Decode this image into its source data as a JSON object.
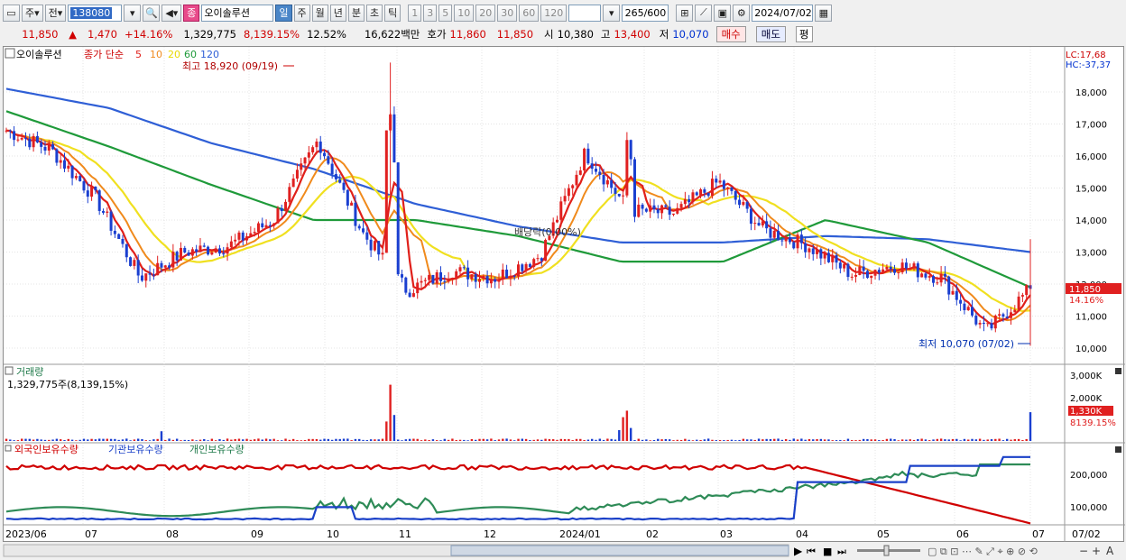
{
  "toolbar": {
    "mode_day": "주",
    "mode_prev": "전",
    "stock_code": "138080",
    "stock_name": "오이솔루션",
    "periods": [
      "일",
      "주",
      "월",
      "년",
      "분",
      "초",
      "틱"
    ],
    "intervals": [
      "1",
      "3",
      "5",
      "10",
      "20",
      "30",
      "60",
      "120"
    ],
    "count": "265",
    "count_max": "/600",
    "date": "2024/07/02",
    "name_badge": "종"
  },
  "quote": {
    "price": "11,850",
    "arrow": "▲",
    "change": "1,470",
    "change_pct": "+14.16%",
    "volume": "1,329,775",
    "vol_ratio": "8,139.15%",
    "turnover": "12.52%",
    "amount": "16,622백만",
    "bid_label": "호가",
    "ask": "11,860",
    "bid": "11,850",
    "open_label": "시",
    "open": "10,380",
    "high_label": "고",
    "high": "13,400",
    "low_label": "저",
    "low": "10,070",
    "buy_label": "매수",
    "sell_label": "매도",
    "p_label": "평"
  },
  "chart": {
    "legend_name": "오이솔루션",
    "legend_ma": "종가 단순",
    "ma_periods": [
      "5",
      "10",
      "20",
      "60",
      "120"
    ],
    "ma_colors": [
      "#e0201a",
      "#f08a1c",
      "#f0e020",
      "#1f9a3a",
      "#2f5fd6"
    ],
    "high_note": "최고 18,920 (09/19)",
    "low_note": "최저 10,070 (07/02)",
    "div_note": "배당락(0.00%)",
    "lc": "LC:17,68",
    "hc": "HC:-37,37",
    "price_tag": "11,850",
    "pct_tag": "14.16%",
    "price_axis": [
      "18,000",
      "17,000",
      "16,000",
      "15,000",
      "14,000",
      "13,000",
      "12,000",
      "11,000",
      "10,000"
    ],
    "volume_title": "거래량",
    "volume_info": "1,329,775주(8,139,15%)",
    "vol_axis": [
      "3,000K",
      "2,000K",
      "1,000K"
    ],
    "vol_tag": "1,330K",
    "vol_pct_tag": "8139.15%",
    "holder_titles": [
      "외국인보유수량",
      "기관보유수량",
      "개인보유수량"
    ],
    "holder_axis": [
      "200,000",
      "100,000"
    ],
    "x_labels": [
      "2023/06",
      "07",
      "08",
      "09",
      "10",
      "11",
      "12",
      "2024/01",
      "02",
      "03",
      "04",
      "05",
      "06",
      "07",
      "07/02"
    ]
  },
  "chart_data": {
    "type": "candlestick",
    "y_range": [
      10000,
      18000
    ],
    "series_price_anchors": [
      {
        "x": "2023/06",
        "close": 16800
      },
      {
        "x": "07",
        "close": 16200
      },
      {
        "x": "07 mid",
        "close": 14700
      },
      {
        "x": "07 end",
        "close": 12200
      },
      {
        "x": "08",
        "close": 13000
      },
      {
        "x": "08 mid",
        "close": 13200
      },
      {
        "x": "09",
        "close": 14000
      },
      {
        "x": "09/19",
        "close": 16500
      },
      {
        "x": "10",
        "close": 13600
      },
      {
        "x": "11",
        "close": 11800
      },
      {
        "x": "11 mid",
        "close": 12400
      },
      {
        "x": "12",
        "close": 12200
      },
      {
        "x": "2024/01",
        "close": 12900
      },
      {
        "x": "01 mid",
        "close": 16100
      },
      {
        "x": "02",
        "close": 14300
      },
      {
        "x": "02 mid",
        "close": 14200
      },
      {
        "x": "03",
        "close": 15200
      },
      {
        "x": "03 mid",
        "close": 13700
      },
      {
        "x": "04",
        "close": 13200
      },
      {
        "x": "04 mid",
        "close": 12300
      },
      {
        "x": "05",
        "close": 12600
      },
      {
        "x": "06",
        "close": 12200
      },
      {
        "x": "06 end",
        "close": 10500
      },
      {
        "x": "07/02",
        "close": 11850
      }
    ],
    "ma120_anchors": [
      18100,
      17500,
      16400,
      15600,
      14500,
      13800,
      13300,
      13300,
      13500,
      13400,
      13000
    ],
    "ma60_anchors": [
      17400,
      16300,
      15100,
      14000,
      14000,
      13500,
      12700,
      12700,
      14000,
      13300,
      11900
    ]
  }
}
